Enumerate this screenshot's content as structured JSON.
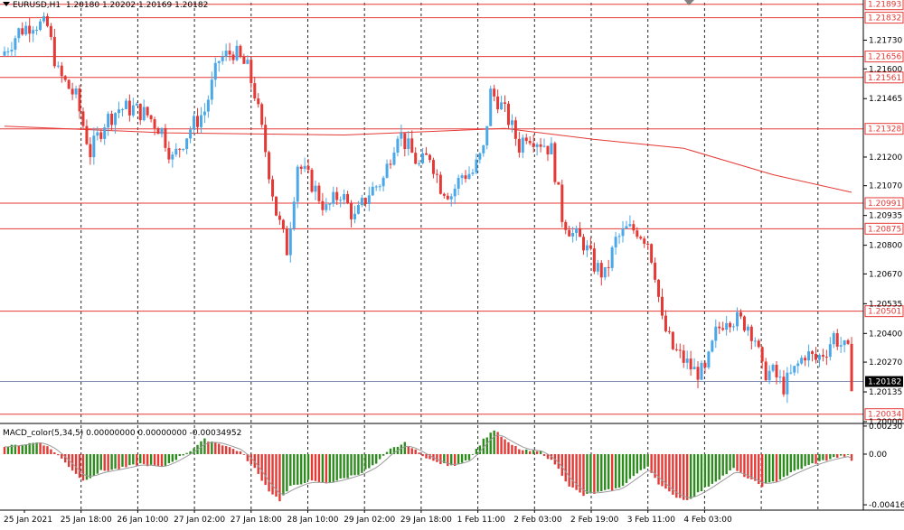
{
  "header": {
    "symbol_timeframe": "EURUSD,H1",
    "ohlc": "1.20180 1.20202 1.20169 1.20182"
  },
  "macd_header": {
    "label": "MACD_color(5,34,5)",
    "values": "0.00000000 0.00000000 -0.00034952"
  },
  "colors": {
    "bull": "#4aa8e8",
    "bear": "#e53935",
    "level_line": "#e53935",
    "ma_line": "#e53935",
    "grid": "#000000",
    "current_price_bg": "#000000",
    "macd_up": "#2e8b1e",
    "macd_down": "#e53935",
    "signal": "#9a9a9a"
  },
  "chart_data": [
    {
      "type": "candlestick",
      "symbol": "EURUSD",
      "timeframe": "H1",
      "ylim": [
        1.2,
        1.219
      ],
      "y_ticks": [
        "1.21730",
        "1.21600",
        "1.21465",
        "1.21200",
        "1.21070",
        "1.20935",
        "1.20800",
        "1.20670",
        "1.20535",
        "1.20400",
        "1.20270",
        "1.20135",
        "1.20000"
      ],
      "x_tick_labels": [
        "25 Jan 2021",
        "25 Jan 18:00",
        "26 Jan 10:00",
        "27 Jan 02:00",
        "27 Jan 18:00",
        "28 Jan 10:00",
        "29 Jan 02:00",
        "29 Jan 18:00",
        "1 Feb 11:00",
        "2 Feb 03:00",
        "2 Feb 19:00",
        "3 Feb 11:00",
        "4 Feb 03:00"
      ],
      "horizontal_levels": [
        "1.21893",
        "1.21832",
        "1.21656",
        "1.21561",
        "1.21328",
        "1.20991",
        "1.20875",
        "1.20501",
        "1.20034"
      ],
      "current_price": "1.20182",
      "close_path": [
        [
          0,
          1.2168
        ],
        [
          4,
          1.2177
        ],
        [
          8,
          1.2181
        ],
        [
          12,
          1.2179
        ],
        [
          15,
          1.2158
        ],
        [
          20,
          1.2147
        ],
        [
          24,
          1.2122
        ],
        [
          28,
          1.2136
        ],
        [
          32,
          1.2142
        ],
        [
          36,
          1.2142
        ],
        [
          40,
          1.2139
        ],
        [
          44,
          1.2132
        ],
        [
          47,
          1.2119
        ],
        [
          52,
          1.2133
        ],
        [
          56,
          1.2141
        ],
        [
          60,
          1.2164
        ],
        [
          64,
          1.2168
        ],
        [
          68,
          1.216
        ],
        [
          70,
          1.2149
        ],
        [
          73,
          1.2123
        ],
        [
          76,
          1.2095
        ],
        [
          79,
          1.2078
        ],
        [
          82,
          1.2117
        ],
        [
          86,
          1.2108
        ],
        [
          90,
          1.2096
        ],
        [
          94,
          1.2104
        ],
        [
          98,
          1.2092
        ],
        [
          102,
          1.2104
        ],
        [
          106,
          1.211
        ],
        [
          110,
          1.2132
        ],
        [
          113,
          1.2124
        ],
        [
          116,
          1.2116
        ],
        [
          119,
          1.2121
        ],
        [
          122,
          1.2107
        ],
        [
          125,
          1.2103
        ],
        [
          128,
          1.2112
        ],
        [
          131,
          1.2113
        ],
        [
          134,
          1.2123
        ],
        [
          136,
          1.2149
        ],
        [
          138,
          1.2146
        ],
        [
          141,
          1.2137
        ],
        [
          144,
          1.2125
        ],
        [
          146,
          1.2131
        ],
        [
          149,
          1.2128
        ],
        [
          151,
          1.2126
        ],
        [
          153,
          1.2123
        ],
        [
          156,
          1.2093
        ],
        [
          159,
          1.2085
        ],
        [
          162,
          1.2081
        ],
        [
          165,
          1.2071
        ],
        [
          168,
          1.2066
        ],
        [
          171,
          1.2082
        ],
        [
          174,
          1.2087
        ],
        [
          177,
          1.2087
        ],
        [
          180,
          1.2082
        ],
        [
          182,
          1.2068
        ],
        [
          184,
          1.2045
        ],
        [
          187,
          1.2033
        ],
        [
          190,
          1.2028
        ],
        [
          193,
          1.2023
        ],
        [
          196,
          1.2022
        ],
        [
          199,
          1.204
        ],
        [
          202,
          1.2048
        ],
        [
          205,
          1.2046
        ],
        [
          208,
          1.2044
        ],
        [
          210,
          1.2038
        ],
        [
          212,
          1.2023
        ],
        [
          215,
          1.2022
        ],
        [
          218,
          1.2016
        ],
        [
          221,
          1.2023
        ],
        [
          224,
          1.2031
        ],
        [
          227,
          1.2028
        ],
        [
          230,
          1.2033
        ],
        [
          232,
          1.2039
        ],
        [
          234,
          1.2035
        ],
        [
          236,
          1.2031
        ],
        [
          237,
          1.20182
        ]
      ],
      "moving_average": [
        [
          0,
          1.2134
        ],
        [
          45,
          1.2131
        ],
        [
          95,
          1.213
        ],
        [
          140,
          1.2133
        ],
        [
          165,
          1.2128
        ],
        [
          190,
          1.2124
        ],
        [
          215,
          1.2112
        ],
        [
          237,
          1.2104
        ]
      ]
    },
    {
      "type": "histogram",
      "title": "MACD_color(5,34,5)",
      "ylim": [
        -0.00416,
        0.0023
      ],
      "y_ticks": [
        "0.0023070",
        "0.00",
        "-0.0041664"
      ],
      "bars_path": [
        [
          0,
          0.0006
        ],
        [
          10,
          0.001
        ],
        [
          14,
          0.0002
        ],
        [
          18,
          -0.001
        ],
        [
          22,
          -0.0022
        ],
        [
          27,
          -0.0014
        ],
        [
          32,
          -0.0012
        ],
        [
          38,
          -0.0008
        ],
        [
          44,
          -0.0011
        ],
        [
          48,
          -0.0004
        ],
        [
          52,
          0.0003
        ],
        [
          56,
          0.0012
        ],
        [
          60,
          0.0009
        ],
        [
          66,
          0.0002
        ],
        [
          70,
          -0.0012
        ],
        [
          74,
          -0.003
        ],
        [
          77,
          -0.0038
        ],
        [
          80,
          -0.0027
        ],
        [
          85,
          -0.0022
        ],
        [
          90,
          -0.0024
        ],
        [
          95,
          -0.002
        ],
        [
          100,
          -0.0015
        ],
        [
          104,
          -0.0008
        ],
        [
          108,
          0.0004
        ],
        [
          112,
          0.0009
        ],
        [
          116,
          0.0001
        ],
        [
          120,
          -0.0006
        ],
        [
          125,
          -0.001
        ],
        [
          130,
          -0.0004
        ],
        [
          134,
          0.0012
        ],
        [
          137,
          0.002
        ],
        [
          141,
          0.0009
        ],
        [
          145,
          0.0003
        ],
        [
          150,
          0.0002
        ],
        [
          154,
          -0.0008
        ],
        [
          158,
          -0.0026
        ],
        [
          162,
          -0.0034
        ],
        [
          167,
          -0.0031
        ],
        [
          172,
          -0.0028
        ],
        [
          176,
          -0.0018
        ],
        [
          180,
          -0.001
        ],
        [
          183,
          -0.0024
        ],
        [
          187,
          -0.0034
        ],
        [
          191,
          -0.0038
        ],
        [
          195,
          -0.003
        ],
        [
          199,
          -0.0022
        ],
        [
          204,
          -0.0012
        ],
        [
          208,
          -0.002
        ],
        [
          212,
          -0.0026
        ],
        [
          216,
          -0.0022
        ],
        [
          221,
          -0.0014
        ],
        [
          226,
          -0.0008
        ],
        [
          232,
          -0.0003
        ],
        [
          236,
          -0.0001
        ],
        [
          237,
          -0.0006
        ]
      ]
    }
  ]
}
